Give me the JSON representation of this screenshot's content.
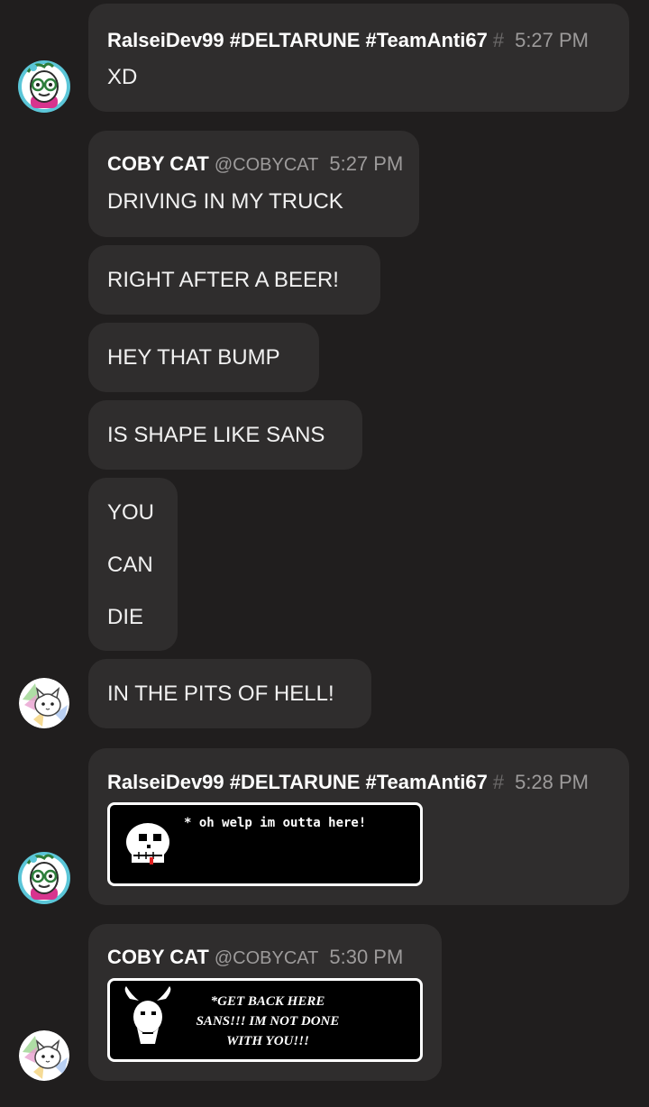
{
  "messages": [
    {
      "author": "RalseiDev99 #DELTARUNE #TeamAnti67",
      "hash": "#",
      "time": "5:27 PM",
      "text": "XD"
    },
    {
      "author": "COBY CAT",
      "handle": "@COBYCAT",
      "time": "5:27 PM",
      "text": "DRIVING IN MY TRUCK"
    },
    {
      "text": "RIGHT AFTER A BEER!"
    },
    {
      "text": "HEY THAT BUMP"
    },
    {
      "text": "IS SHAPE LIKE SANS"
    },
    {
      "lines": [
        "YOU",
        "CAN",
        "DIE"
      ]
    },
    {
      "text": "IN THE PITS OF HELL!"
    },
    {
      "author": "RalseiDev99 #DELTARUNE #TeamAnti67",
      "hash": "#",
      "time": "5:28 PM",
      "image_caption": "* oh welp im outta here!"
    },
    {
      "author": "COBY CAT",
      "handle": "@COBYCAT",
      "time": "5:30 PM",
      "image_caption": "*GET BACK HERE SANS!!! IM NOT DONE WITH YOU!!!"
    }
  ],
  "avatars": {
    "ralsei": "ralsei-avatar-icon",
    "cobycat": "cobycat-avatar-icon"
  },
  "colors": {
    "background": "#201e1e",
    "bubble": "#2f2d2d",
    "timestamp": "#9d9b9b"
  }
}
